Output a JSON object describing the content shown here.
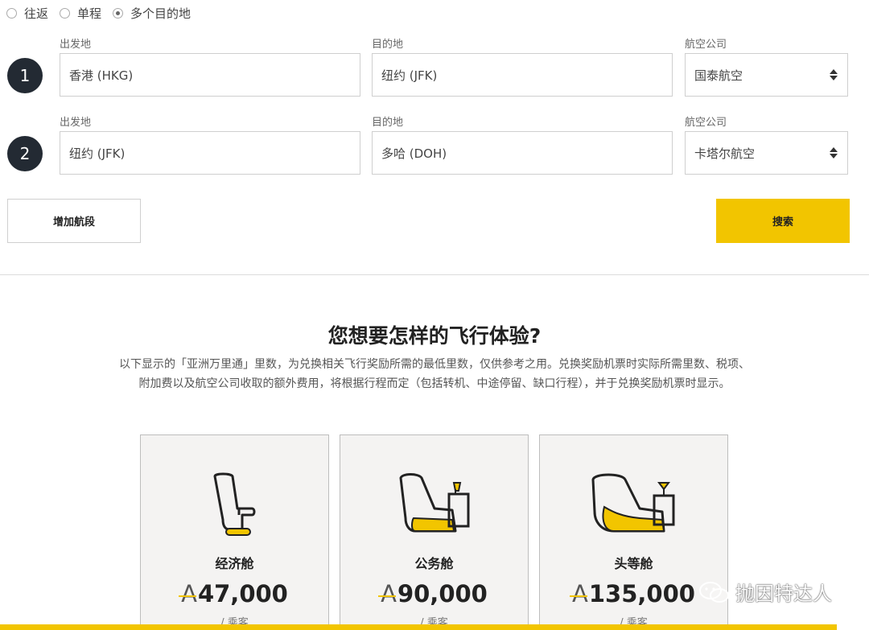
{
  "trip_types": [
    {
      "label": "往返",
      "selected": false
    },
    {
      "label": "单程",
      "selected": false
    },
    {
      "label": "多个目的地",
      "selected": true
    }
  ],
  "labels": {
    "origin": "出发地",
    "destination": "目的地",
    "airline": "航空公司"
  },
  "segments": [
    {
      "number": "1",
      "origin": "香港 (HKG)",
      "destination": "纽约 (JFK)",
      "airline": "国泰航空"
    },
    {
      "number": "2",
      "origin": "纽约 (JFK)",
      "destination": "多哈 (DOH)",
      "airline": "卡塔尔航空"
    }
  ],
  "buttons": {
    "add_segment": "增加航段",
    "search": "搜索"
  },
  "experience": {
    "title": "您想要怎样的飞行体验?",
    "desc_line1": "以下显示的「亚洲万里通」里数，为兑换相关飞行奖励所需的最低里数，仅供参考之用。兑换奖励机票时实际所需里数、税项、",
    "desc_line2": "附加费以及航空公司收取的额外费用，将根据行程而定（包括转机、中途停留、缺口行程），并于兑换奖励机票时显示。"
  },
  "cabins": [
    {
      "name": "经济舱",
      "miles_icon": "A",
      "miles": "47,000",
      "per": "/ 乘客",
      "icon": "economy-seat-icon"
    },
    {
      "name": "公务舱",
      "miles_icon": "A",
      "miles": "90,000",
      "per": "/ 乘客",
      "icon": "business-seat-icon"
    },
    {
      "name": "头等舱",
      "miles_icon": "A",
      "miles": "135,000",
      "per": "/ 乘客",
      "icon": "first-seat-icon"
    }
  ],
  "watermark": {
    "text": "抛因特达人"
  },
  "colors": {
    "accent": "#f2c500",
    "badge": "#232a33",
    "card_bg": "#f4f3f2"
  }
}
